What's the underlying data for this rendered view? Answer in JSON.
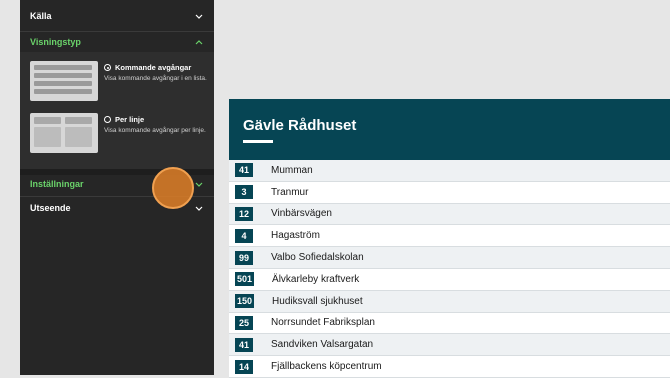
{
  "sidebar": {
    "sections": {
      "source": "Källa",
      "display_type": "Visningstyp",
      "settings": "Inställningar",
      "appearance": "Utseende"
    },
    "options": [
      {
        "title": "Kommande avgångar",
        "description": "Visa kommande avgångar i en lista.",
        "selected": true
      },
      {
        "title": "Per linje",
        "description": "Visa kommande avgångar per linje.",
        "selected": false
      }
    ]
  },
  "board": {
    "title": "Gävle Rådhuset",
    "rows": [
      {
        "line": "41",
        "destination": "Mumman"
      },
      {
        "line": "3",
        "destination": "Tranmur"
      },
      {
        "line": "12",
        "destination": "Vinbärsvägen"
      },
      {
        "line": "4",
        "destination": "Hagaström"
      },
      {
        "line": "99",
        "destination": "Valbo Sofiedalskolan"
      },
      {
        "line": "501",
        "destination": "Älvkarleby kraftverk"
      },
      {
        "line": "150",
        "destination": "Hudiksvall sjukhuset"
      },
      {
        "line": "25",
        "destination": "Norrsundet Fabriksplan"
      },
      {
        "line": "41",
        "destination": "Sandviken Valsargatan"
      },
      {
        "line": "14",
        "destination": "Fjällbackens köpcentrum"
      }
    ]
  },
  "colors": {
    "sidebar_bg": "#262626",
    "accent_green": "#6ad26a",
    "board_header": "#064554",
    "badge": "#064554",
    "cursor": "#e08028"
  },
  "icons": {
    "chevron_down": "chevron-down-icon",
    "chevron_up": "chevron-up-icon"
  }
}
